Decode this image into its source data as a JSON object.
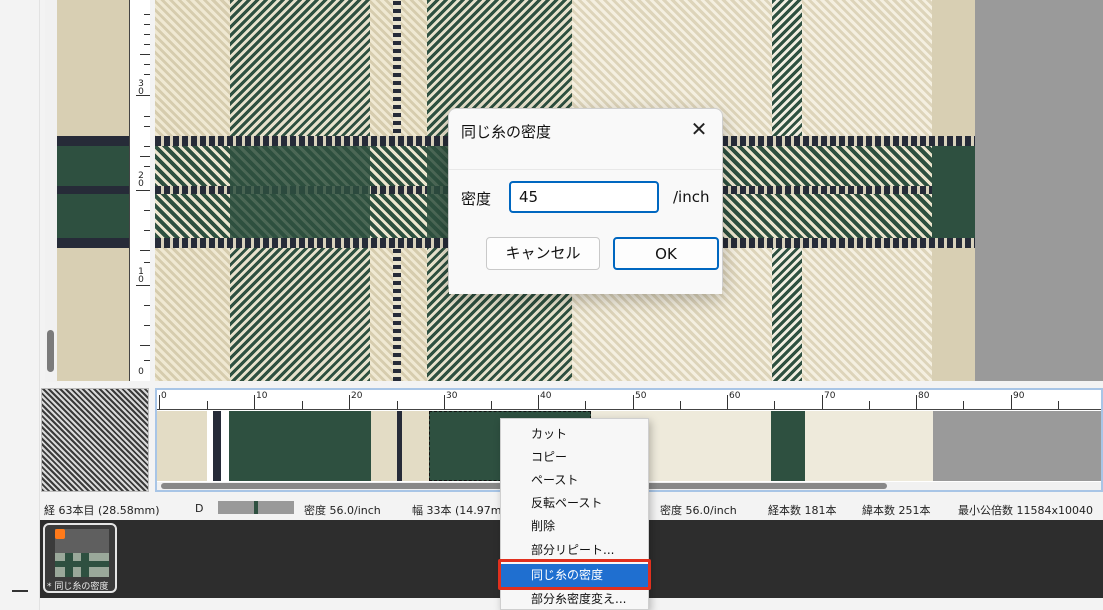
{
  "ruler": {
    "vertical_labels": [
      "3\n0",
      "2\n0",
      "1\n0",
      "0"
    ],
    "horizontal_labels": [
      "0",
      "10",
      "20",
      "30",
      "40",
      "50",
      "60",
      "70",
      "80",
      "90"
    ]
  },
  "dialog": {
    "title": "同じ糸の密度",
    "close_glyph": "✕",
    "density_label": "密度",
    "density_value": "45",
    "unit": "/inch",
    "cancel_label": "キャンセル",
    "ok_label": "OK"
  },
  "status": {
    "warp_position": "経 63本目 (28.58mm)",
    "mode": "D",
    "density_left": "密度 56.0/inch",
    "width": "幅 33本 (14.97m",
    "density_right": "密度 56.0/inch",
    "warp_count": "経本数 181本",
    "weft_count": "緯本数 251本",
    "lcm": "最小公倍数 11584x10040"
  },
  "thumbnail": {
    "caption": "* 同じ糸の密度"
  },
  "context_menu": {
    "items": [
      "カット",
      "コピー",
      "ペースト",
      "反転ペースト",
      "削除",
      "部分リピート...",
      "同じ糸の密度",
      "部分糸密度変え..."
    ],
    "selected_index": 6
  },
  "colors": {
    "dark_green": "#2e5040",
    "cream": "#ede6cf",
    "beige": "#d8cfb3",
    "navy": "#262b38",
    "gray": "#9a9a9a",
    "accent": "#0067c0",
    "highlight_red": "#e0301e"
  }
}
